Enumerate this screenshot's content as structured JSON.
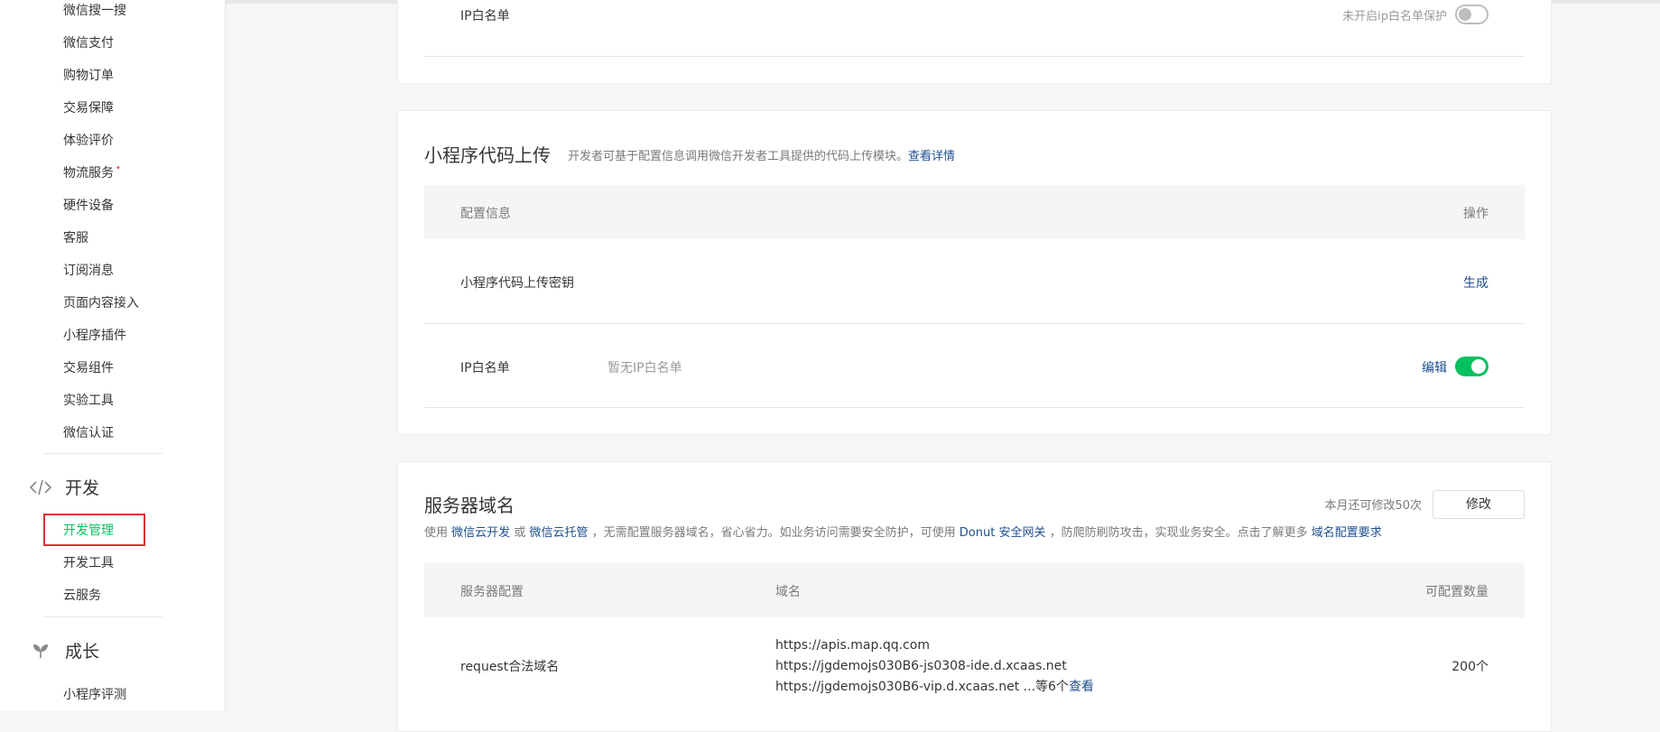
{
  "sidebar": {
    "items_top": [
      {
        "label": "微信搜一搜"
      },
      {
        "label": "微信支付"
      },
      {
        "label": "购物订单"
      },
      {
        "label": "交易保障"
      },
      {
        "label": "体验评价"
      },
      {
        "label": "物流服务",
        "dot": "•"
      },
      {
        "label": "硬件设备"
      },
      {
        "label": "客服"
      },
      {
        "label": "订阅消息"
      },
      {
        "label": "页面内容接入"
      },
      {
        "label": "小程序插件"
      },
      {
        "label": "交易组件"
      },
      {
        "label": "实验工具"
      },
      {
        "label": "微信认证"
      }
    ],
    "dev_group": {
      "label": "开发",
      "icon": "code-icon"
    },
    "dev_items": [
      {
        "label": "开发管理",
        "active": true
      },
      {
        "label": "开发工具"
      },
      {
        "label": "云服务"
      }
    ],
    "growth_group": {
      "label": "成长",
      "icon": "sprout-icon"
    },
    "growth_items": [
      {
        "label": "小程序评测"
      }
    ]
  },
  "ip_card_top": {
    "label": "IP白名单",
    "toggle_text": "未开启ip白名单保护",
    "toggle_state": "off"
  },
  "upload_card": {
    "title": "小程序代码上传",
    "desc": "开发者可基于配置信息调用微信开发者工具提供的代码上传模块。",
    "desc_link": "查看详情",
    "header_col1": "配置信息",
    "header_col2": "操作",
    "row1_label": "小程序代码上传密钥",
    "row1_action": "生成",
    "row2_label": "IP白名单",
    "row2_value": "暂无IP白名单",
    "row2_action": "编辑",
    "row2_toggle_state": "on"
  },
  "server_card": {
    "title": "服务器域名",
    "remain_text": "本月还可修改50次",
    "modify_button": "修改",
    "desc_part1": "使用",
    "desc_link1": "微信云开发",
    "desc_part2": "或",
    "desc_link2": "微信云托管",
    "desc_part3": "，无需配置服务器域名，省心省力。如业务访问需要安全防护，可使用",
    "desc_link3": "Donut 安全网关",
    "desc_part4": "，防爬防刷防攻击，实现业务安全。点击了解更多",
    "desc_link4": "域名配置要求",
    "header_col1": "服务器配置",
    "header_col2": "域名",
    "header_col3": "可配置数量",
    "row1_label": "request合法域名",
    "row1_domains": [
      "https://apis.map.qq.com",
      "https://jgdemojs030B6-js0308-ide.d.xcaas.net",
      "https://jgdemojs030B6-vip.d.xcaas.net ...等6个"
    ],
    "row1_view": "查看",
    "row1_count": "200个"
  },
  "colors": {
    "accent": "#07c160",
    "link": "#1e4f8f",
    "highlight_box": "#e02f2f"
  }
}
